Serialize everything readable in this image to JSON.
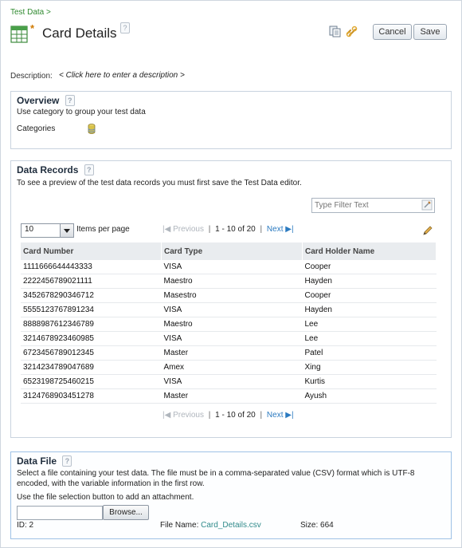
{
  "breadcrumb": "Test Data >",
  "header": {
    "dirty_marker": "*",
    "title": "Card Details",
    "help": "?",
    "cancel_label": "Cancel",
    "save_label": "Save"
  },
  "description": {
    "label": "Description:",
    "link": "< Click here to enter a description >"
  },
  "overview": {
    "heading": "Overview",
    "text": "Use category to group your test data",
    "categories_label": "Categories"
  },
  "data_records": {
    "heading": "Data Records",
    "note": "To see a preview of the test data records you must first save the Test Data editor.",
    "filter_placeholder": "Type Filter Text",
    "page_size": "10",
    "items_per_page_label": "Items per page",
    "pager": {
      "previous": "Previous",
      "range": "1 - 10 of 20",
      "next": "Next"
    },
    "columns": [
      "Card Number",
      "Card Type",
      "Card Holder Name"
    ],
    "rows": [
      [
        "1111666644443333",
        "VISA",
        "Cooper"
      ],
      [
        "2222456789021111",
        "Maestro",
        "Hayden"
      ],
      [
        "3452678290346712",
        "Masestro",
        "Cooper"
      ],
      [
        "5555123767891234",
        "VISA",
        "Hayden"
      ],
      [
        "8888987612346789",
        "Maestro",
        "Lee"
      ],
      [
        "3214678923460985",
        "VISA",
        "Lee"
      ],
      [
        "6723456789012345",
        "Master",
        "Patel"
      ],
      [
        "3214234789047689",
        "Amex",
        "Xing"
      ],
      [
        "6523198725460215",
        "VISA",
        "Kurtis"
      ],
      [
        "3124768903451278",
        "Master",
        "Ayush"
      ]
    ]
  },
  "data_file": {
    "heading": "Data File",
    "text1": "Select a file containing your test data. The file must be in a comma-separated value (CSV) format which is UTF-8",
    "text2": "encoded, with the variable information in the first row.",
    "text3": "Use the file selection button to add an attachment.",
    "browse_label": "Browse...",
    "id_text": "ID: 2",
    "file_name_label": "File Name:",
    "file_name": "Card_Details.csv",
    "size_text": "Size: 664"
  },
  "colors": {
    "link_green": "#2f8a2f",
    "link_blue": "#2b7ac0",
    "section_border_blue": "#9ec1e6"
  }
}
